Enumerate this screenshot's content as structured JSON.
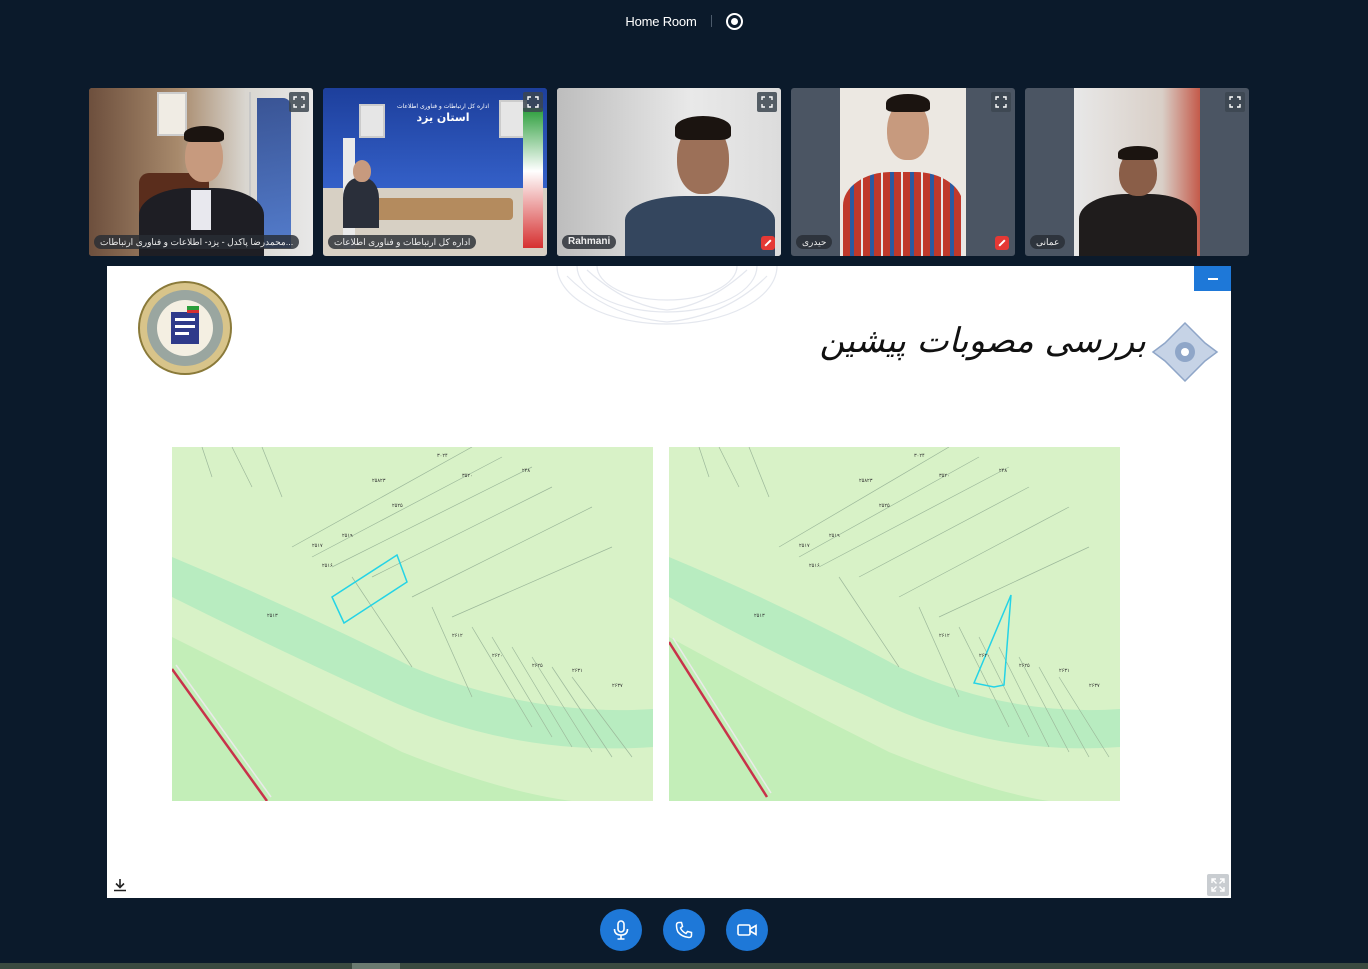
{
  "header": {
    "room_name": "Home Room",
    "record_icon": "record-icon"
  },
  "participants": [
    {
      "name": "محمدرضا پاکدل - یزد- اطلاعات و فناوری ارتباطات...",
      "muted": false
    },
    {
      "name": "اداره کل ارتباطات و فناوری اطلاعات",
      "muted": false
    },
    {
      "name": "Rahmani",
      "muted": true
    },
    {
      "name": "حیدری",
      "muted": true
    },
    {
      "name": "عمانی",
      "muted": false
    }
  ],
  "room_banner": {
    "line1": "اداره کل ارتباطات و فناوری اطلاعات",
    "line2": "استان یزد"
  },
  "slide": {
    "title": "بررسی مصوبات پیشین"
  },
  "controls": {
    "mic": "microphone-icon",
    "phone": "phone-icon",
    "camera": "video-camera-icon"
  },
  "colors": {
    "background": "#0b1a2b",
    "accent": "#1e78d8",
    "muted": "#e53935",
    "map_land": "#d8f2c7",
    "map_road": "#b8ecc0",
    "highlight": "#24d3e6"
  }
}
